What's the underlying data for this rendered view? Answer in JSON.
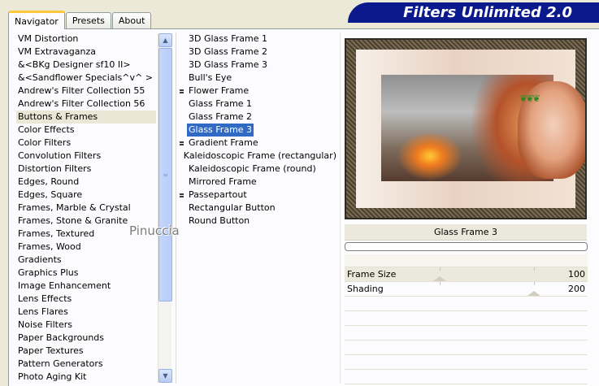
{
  "tabs": [
    {
      "label": "Navigator",
      "active": true
    },
    {
      "label": "Presets",
      "active": false
    },
    {
      "label": "About",
      "active": false
    }
  ],
  "banner": "Filters Unlimited 2.0",
  "categories": [
    {
      "label": "VM Distortion",
      "selected": false
    },
    {
      "label": "VM Extravaganza",
      "selected": false
    },
    {
      "label": "&<BKg Designer sf10 II>",
      "selected": false
    },
    {
      "label": "&<Sandflower Specials^v^ >",
      "selected": false
    },
    {
      "label": "Andrew's Filter Collection 55",
      "selected": false
    },
    {
      "label": "Andrew's Filter Collection 56",
      "selected": false
    },
    {
      "label": "Buttons & Frames",
      "selected": true
    },
    {
      "label": "Color Effects",
      "selected": false
    },
    {
      "label": "Color Filters",
      "selected": false
    },
    {
      "label": "Convolution Filters",
      "selected": false
    },
    {
      "label": "Distortion Filters",
      "selected": false
    },
    {
      "label": "Edges, Round",
      "selected": false
    },
    {
      "label": "Edges, Square",
      "selected": false
    },
    {
      "label": "Frames, Marble & Crystal",
      "selected": false
    },
    {
      "label": "Frames, Stone & Granite",
      "selected": false
    },
    {
      "label": "Frames, Textured",
      "selected": false
    },
    {
      "label": "Frames, Wood",
      "selected": false
    },
    {
      "label": "Gradients",
      "selected": false
    },
    {
      "label": "Graphics Plus",
      "selected": false
    },
    {
      "label": "Image Enhancement",
      "selected": false
    },
    {
      "label": "Lens Effects",
      "selected": false
    },
    {
      "label": "Lens Flares",
      "selected": false
    },
    {
      "label": "Noise Filters",
      "selected": false
    },
    {
      "label": "Paper Backgrounds",
      "selected": false
    },
    {
      "label": "Paper Textures",
      "selected": false
    },
    {
      "label": "Pattern Generators",
      "selected": false
    },
    {
      "label": "Photo Aging Kit",
      "selected": false
    }
  ],
  "filters": [
    {
      "label": "3D Glass Frame 1",
      "marked": false,
      "selected": false
    },
    {
      "label": "3D Glass Frame 2",
      "marked": false,
      "selected": false
    },
    {
      "label": "3D Glass Frame 3",
      "marked": false,
      "selected": false
    },
    {
      "label": "Bull's Eye",
      "marked": false,
      "selected": false
    },
    {
      "label": "Flower Frame",
      "marked": true,
      "selected": false
    },
    {
      "label": "Glass Frame 1",
      "marked": false,
      "selected": false
    },
    {
      "label": "Glass Frame 2",
      "marked": false,
      "selected": false
    },
    {
      "label": "Glass Frame 3",
      "marked": false,
      "selected": true
    },
    {
      "label": "Gradient Frame",
      "marked": true,
      "selected": false
    },
    {
      "label": "Kaleidoscopic Frame (rectangular)",
      "marked": false,
      "selected": false
    },
    {
      "label": "Kaleidoscopic Frame (round)",
      "marked": false,
      "selected": false
    },
    {
      "label": "Mirrored Frame",
      "marked": false,
      "selected": false
    },
    {
      "label": "Passepartout",
      "marked": true,
      "selected": false
    },
    {
      "label": "Rectangular Button",
      "marked": false,
      "selected": false
    },
    {
      "label": "Round Button",
      "marked": false,
      "selected": false
    }
  ],
  "preview_filter_name": "Glass Frame 3",
  "parameters": [
    {
      "label": "Frame Size",
      "value": "100",
      "level": 0.39
    },
    {
      "label": "Shading",
      "value": "200",
      "level": 0.78
    }
  ],
  "empty_param_rows": 6,
  "watermark": "Pinuccia",
  "icons": {
    "scroll_up": "scroll-up-arrow-icon",
    "scroll_down": "scroll-down-arrow-icon",
    "thumb_grip": "grip-icon"
  },
  "colors": {
    "banner": "#0a1a8c",
    "selection": "#316ac5",
    "active_tab": "#ffc73c"
  }
}
